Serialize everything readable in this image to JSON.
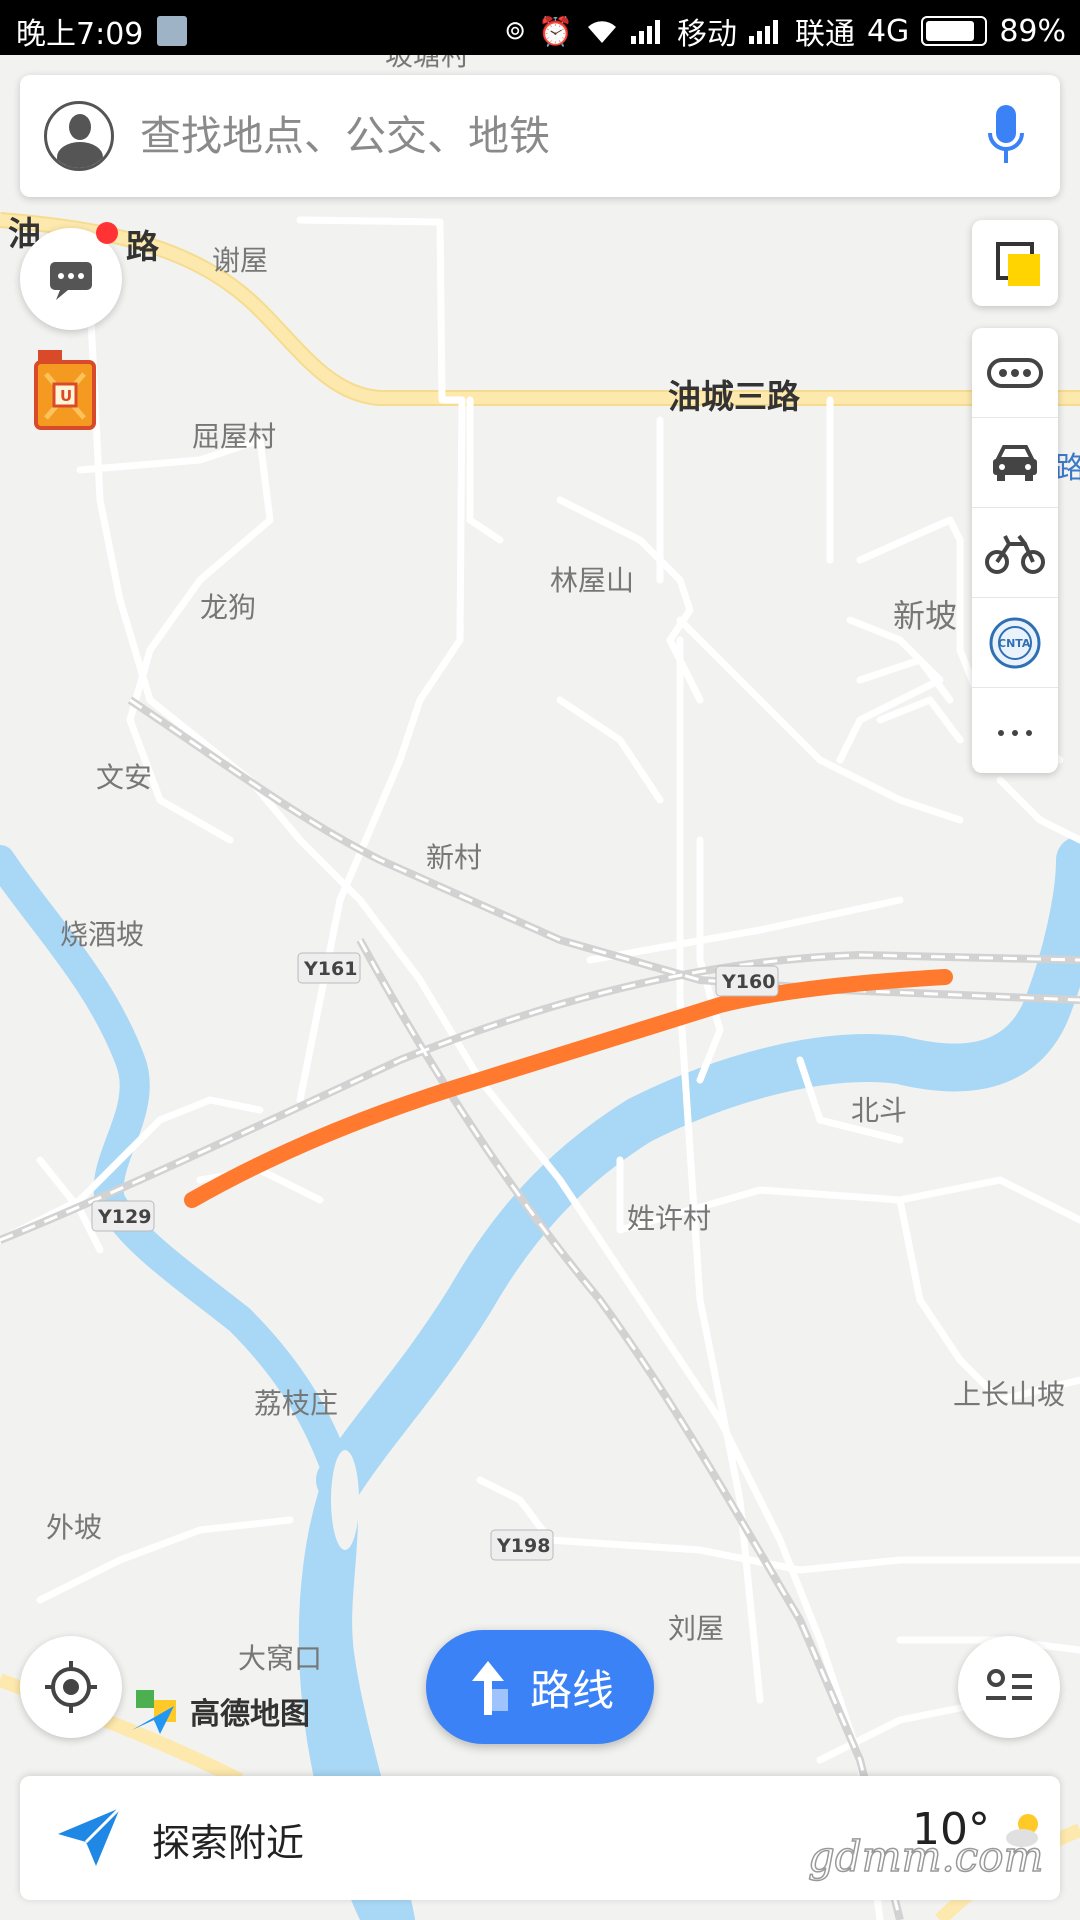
{
  "status_bar": {
    "time": "晚上7:09",
    "carrier1": "移动",
    "carrier2": "联通",
    "network": "4G",
    "battery": "89%",
    "battery_level": 0.89
  },
  "search": {
    "placeholder": "查找地点、公交、地铁"
  },
  "map": {
    "place_labels": {
      "xiewu": "谢屋",
      "youcheng_road3": "油城三路",
      "quwucun": "屈屋村",
      "linwushan": "林屋山",
      "longgou": "龙狗",
      "xinpo": "新坡",
      "wenan": "文安",
      "xincun": "新村",
      "shaojiupo": "烧酒坡",
      "beidou": "北斗",
      "xingxucun": "姓许村",
      "lizhizhuang": "荔枝庄",
      "shangchangshanpo": "上长山坡",
      "waipo": "外坡",
      "liuwu": "刘屋",
      "dawokou": "大窝口",
      "top_partial": "坡塘村",
      "left_road_a": "油",
      "left_road_b": "路"
    },
    "road_shields": {
      "y161": "Y161",
      "y160": "Y160",
      "y129": "Y129",
      "y198": "Y198"
    },
    "colors": {
      "route": "#ff7a2e",
      "river": "#a8d8f5",
      "main_road": "#fde7a6"
    }
  },
  "controls": {
    "layers_icon": "layers-icon",
    "message_icon": "message-icon",
    "gas_station_icon": "gas-station-icon",
    "traffic_icon": "traffic-icon",
    "taxi_icon": "taxi-icon",
    "bike_icon": "bike-icon",
    "tourism_icon": "tourism-icon",
    "more_icon": "more-icon",
    "locate_icon": "locate-icon",
    "list_icon": "list-icon"
  },
  "route_button": {
    "label": "路线"
  },
  "logo": {
    "text": "高德地图"
  },
  "bottom_bar": {
    "explore_label": "探索附近",
    "temperature": "10°"
  },
  "watermark": {
    "text": "gdmm.com"
  }
}
